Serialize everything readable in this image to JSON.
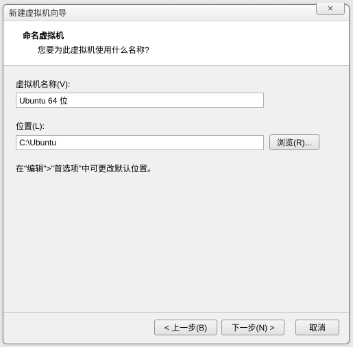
{
  "titlebar": {
    "title": "新建虚拟机向导",
    "close_glyph": "✕"
  },
  "header": {
    "title": "命名虚拟机",
    "subtitle": "您要为此虚拟机使用什么名称?"
  },
  "fields": {
    "name_label": "虚拟机名称(V):",
    "name_value": "Ubuntu 64 位",
    "location_label": "位置(L):",
    "location_value": "C:\\Ubuntu",
    "browse_label": "浏览(R)..."
  },
  "hint": "在\"编辑\">\"首选项\"中可更改默认位置。",
  "footer": {
    "back": "< 上一步(B)",
    "next": "下一步(N) >",
    "cancel": "取消"
  }
}
